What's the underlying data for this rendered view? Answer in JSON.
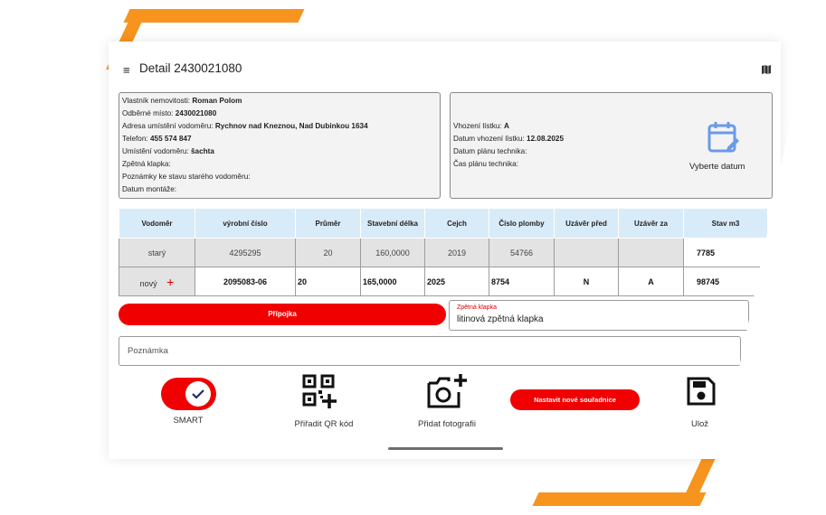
{
  "header": {
    "title": "Detail 2430021080"
  },
  "info_left": {
    "owner_label": "Vlastník nemovitosti:",
    "owner_value": "Roman Polom",
    "point_label": "Odběrné místo:",
    "point_value": "2430021080",
    "address_label": "Adresa umístění vodoměru:",
    "address_value": "Rychnov nad Kneznou, Nad Dubinkou 1634",
    "phone_label": "Telefon:",
    "phone_value": "455 574 847",
    "location_label": "Umístění vodoměru:",
    "location_value": "šachta",
    "valve_label": "Zpětná klapka:",
    "notes_label": "Poznámky ke stavu starého vodoměru:",
    "install_label": "Datum montáže:"
  },
  "info_right": {
    "ticket_label": "Vhození lístku:",
    "ticket_value": "A",
    "ticket_date_label": "Datum vhození lístku:",
    "ticket_date_value": "12.08.2025",
    "plan_date_label": "Datum plánu technika:",
    "plan_time_label": "Čas plánu technika:",
    "select_date": "Vyberte datum",
    "accent_color": "#6a9ae8"
  },
  "table": {
    "headers": [
      "Vodoměr",
      "výrobní číslo",
      "Průměr",
      "Stavební délka",
      "Cejch",
      "Číslo plomby",
      "Uzávěr před",
      "Uzávěr za",
      "Stav m3"
    ],
    "old": [
      "starý",
      "4295295",
      "20",
      "160,0000",
      "2019",
      "54766",
      "",
      "",
      "7785"
    ],
    "new": [
      "nový",
      "2095083-06",
      "20",
      "165,0000",
      "2025",
      "8754",
      "N",
      "A",
      "98745"
    ],
    "add_symbol": "+"
  },
  "connection_button": "Přípojka",
  "valve_field": {
    "label": "Zpětná klapka",
    "value": "litinová zpětná klapka"
  },
  "note_field": {
    "placeholder": "Poznámka"
  },
  "actions": {
    "smart_label": "SMART",
    "qr_label": "Přiřadit QR kód",
    "photo_label": "Přidat fotografii",
    "coords_button": "Nastavit nové souřadnice",
    "save_label": "Ulož"
  },
  "colors": {
    "brand_red": "#f00000",
    "table_header": "#d8ebf8",
    "frame_orange": "#f7941d"
  }
}
